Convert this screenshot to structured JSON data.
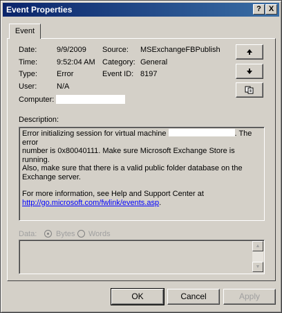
{
  "window": {
    "title": "Event Properties",
    "help_label": "?",
    "close_label": "X"
  },
  "tab": {
    "label": "Event"
  },
  "fields": {
    "date_label": "Date:",
    "date_value": "9/9/2009",
    "time_label": "Time:",
    "time_value": "9:52:04 AM",
    "type_label": "Type:",
    "type_value": "Error",
    "user_label": "User:",
    "user_value": "N/A",
    "computer_label": "Computer:",
    "source_label": "Source:",
    "source_value": "MSExchangeFBPublish",
    "category_label": "Category:",
    "category_value": "General",
    "eventid_label": "Event ID:",
    "eventid_value": "8197"
  },
  "description": {
    "label": "Description:",
    "line1_pre": "Error initializing session for virtual machine",
    "line1_post": ". The error",
    "line2": "number is 0x80040111. Make sure Microsoft Exchange Store is running.",
    "line3": "Also, make sure that there is a valid public folder database on the",
    "line4": "Exchange server.",
    "line5": "For more information, see Help and Support Center at",
    "link": "http://go.microsoft.com/fwlink/events.asp",
    "link_suffix": "."
  },
  "data_section": {
    "label": "Data:",
    "bytes_label": "Bytes",
    "words_label": "Words",
    "selected": "Bytes"
  },
  "buttons": {
    "ok": "OK",
    "cancel": "Cancel",
    "apply": "Apply"
  },
  "icons": {
    "up": "arrow-up-icon",
    "down": "arrow-down-icon",
    "copy": "copy-icon"
  }
}
